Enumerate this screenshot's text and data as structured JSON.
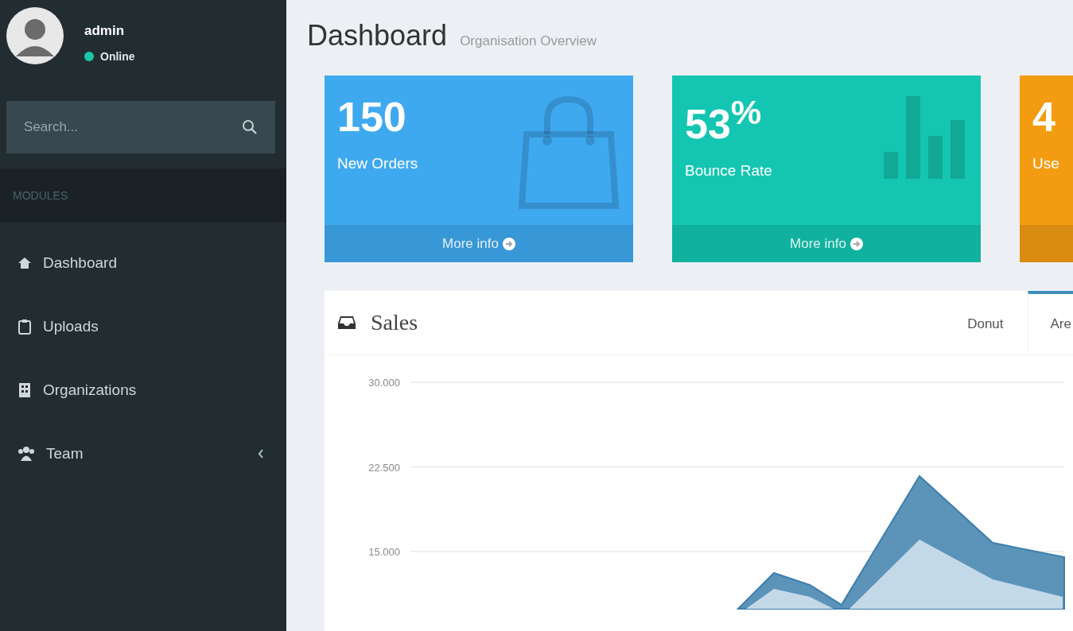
{
  "sidebar": {
    "user": {
      "name": "admin",
      "status": "Online",
      "online": true
    },
    "search": {
      "placeholder": "Search..."
    },
    "section": "MODULES",
    "items": [
      {
        "label": "Dashboard",
        "expandable": false
      },
      {
        "label": "Uploads",
        "expandable": false
      },
      {
        "label": "Organizations",
        "expandable": false
      },
      {
        "label": "Team",
        "expandable": true
      }
    ]
  },
  "header": {
    "title": "Dashboard",
    "subtitle": "Organisation Overview"
  },
  "stats": [
    {
      "value": "150",
      "label": "New Orders",
      "footer": "More info",
      "color": "#3fa9f0"
    },
    {
      "value": "53$^{%}$",
      "label": "Bounce Rate",
      "footer": "More info",
      "color": "#14c6b1"
    },
    {
      "value": "4",
      "label": "Use",
      "color": "#f39c12"
    }
  ],
  "sales": {
    "title": "Sales",
    "tabs": [
      {
        "label": "Donut",
        "selected": false
      },
      {
        "label": "Are",
        "selected": true
      }
    ],
    "y_axis_labels": [
      "30.000",
      "22.500",
      "15.000"
    ]
  }
}
